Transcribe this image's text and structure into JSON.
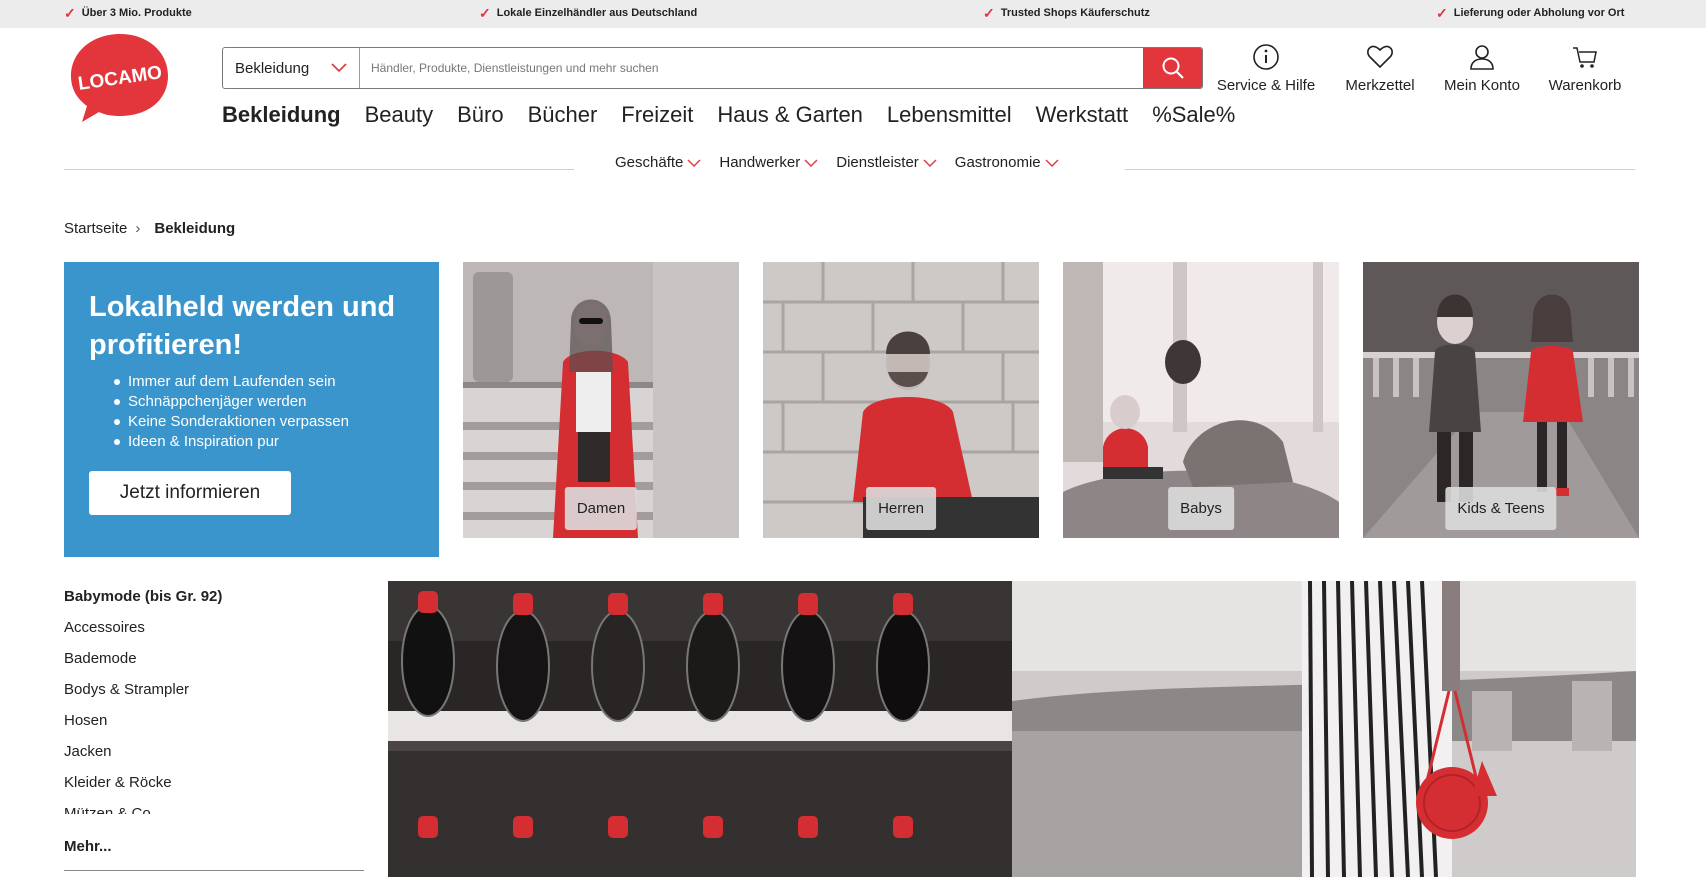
{
  "usp_bar": {
    "items": [
      "Über 3 Mio. Produkte",
      "Lokale Einzelhändler aus Deutschland",
      "Trusted Shops Käuferschutz",
      "Lieferung oder Abholung vor Ort"
    ]
  },
  "logo": {
    "text": "LOCAMO"
  },
  "search": {
    "category": "Bekleidung",
    "placeholder": "Händler, Produkte, Dienstleistungen und mehr suchen"
  },
  "header_actions": {
    "service": "Service & Hilfe",
    "wishlist": "Merkzettel",
    "account": "Mein Konto",
    "cart": "Warenkorb"
  },
  "main_nav": {
    "items": [
      "Bekleidung",
      "Beauty",
      "Büro",
      "Bücher",
      "Freizeit",
      "Haus & Garten",
      "Lebensmittel",
      "Werkstatt",
      "%Sale%"
    ],
    "active": "Bekleidung"
  },
  "sub_nav": {
    "items": [
      "Geschäfte",
      "Handwerker",
      "Dienstleister",
      "Gastronomie"
    ]
  },
  "breadcrumb": {
    "home": "Startseite",
    "current": "Bekleidung"
  },
  "promo": {
    "title": "Lokalheld werden und profitieren!",
    "bullets": [
      "Immer auf dem Laufenden sein",
      "Schnäppchenjäger werden",
      "Keine Sonderaktionen verpassen",
      "Ideen & Inspiration pur"
    ],
    "button": "Jetzt informieren"
  },
  "category_tiles": [
    {
      "label": "Damen"
    },
    {
      "label": "Herren"
    },
    {
      "label": "Babys"
    },
    {
      "label": "Kids & Teens"
    }
  ],
  "sidebar": {
    "items": [
      "Babymode (bis Gr. 92)",
      "Accessoires",
      "Bademode",
      "Bodys & Strampler",
      "Hosen",
      "Jacken",
      "Kleider & Röcke",
      "Mützen & Co."
    ],
    "more": "Mehr..."
  },
  "colors": {
    "accent_red": "#e2353c",
    "promo_blue": "#3a95cc",
    "usp_bg": "#ececec"
  }
}
